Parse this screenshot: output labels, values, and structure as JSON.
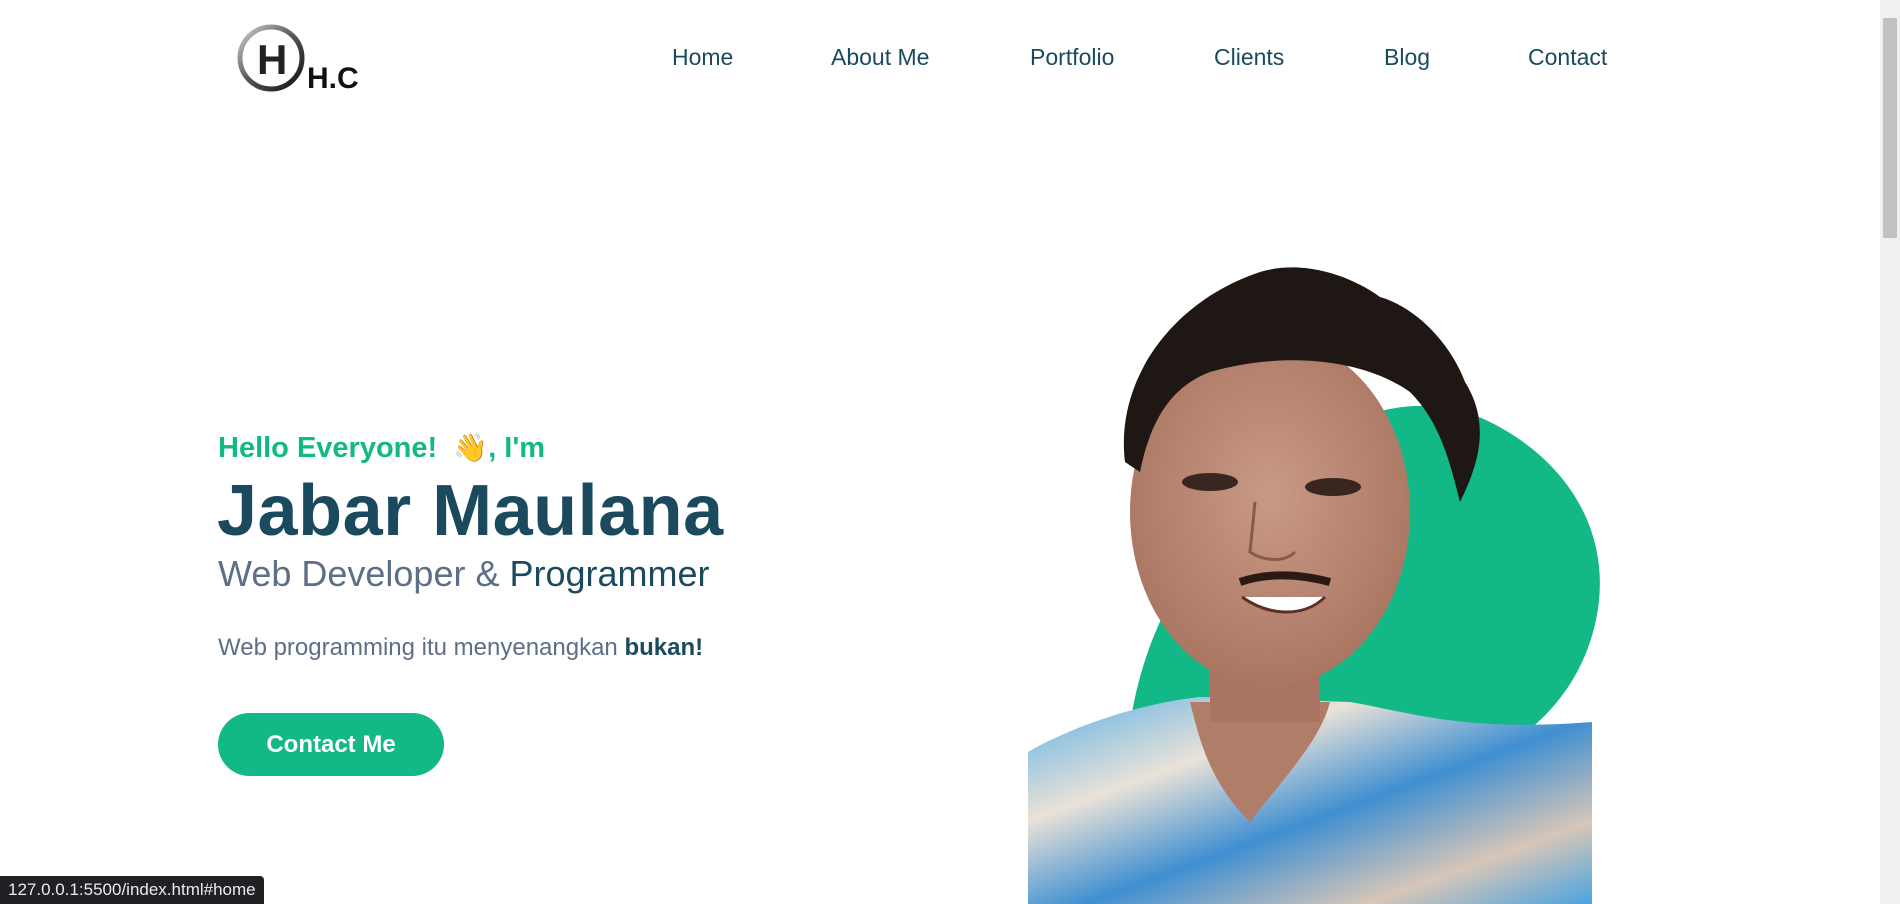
{
  "brand": {
    "logo_text": "H.C",
    "logo_letter": "H"
  },
  "nav": {
    "items": [
      {
        "label": "Home"
      },
      {
        "label": "About Me"
      },
      {
        "label": "Portfolio"
      },
      {
        "label": "Clients"
      },
      {
        "label": "Blog"
      },
      {
        "label": "Contact"
      }
    ]
  },
  "hero": {
    "greeting_prefix": "Hello Everyone!",
    "greeting_emoji": "👋",
    "greeting_suffix": ", I'm",
    "name": "Jabar Maulana",
    "role_part1": "Web Developer &",
    "role_part2": "Programmer",
    "tagline": "Web programming itu menyenangkan",
    "tagline_emphasis": "bukan!",
    "cta_label": "Contact Me"
  },
  "status_bar": {
    "url": "127.0.0.1:5500/index.html#home"
  },
  "colors": {
    "accent": "#12b886",
    "heading": "#1b4a5e",
    "muted": "#5d6f86"
  }
}
